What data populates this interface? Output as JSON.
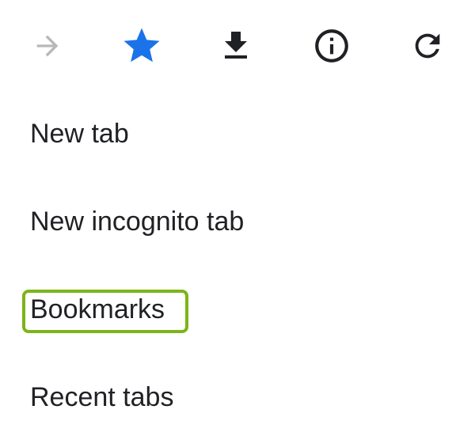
{
  "toolbar": {
    "buttons": [
      {
        "icon": "arrow-forward-icon",
        "state": "disabled"
      },
      {
        "icon": "star-icon",
        "state": "active"
      },
      {
        "icon": "download-icon",
        "state": "normal"
      },
      {
        "icon": "info-icon",
        "state": "normal"
      },
      {
        "icon": "refresh-icon",
        "state": "normal"
      }
    ]
  },
  "menu": {
    "items": [
      {
        "label": "New tab"
      },
      {
        "label": "New incognito tab"
      },
      {
        "label": "Bookmarks"
      },
      {
        "label": "Recent tabs"
      }
    ]
  },
  "colors": {
    "icon_default": "#202124",
    "icon_disabled": "#b8b8b8",
    "icon_active": "#1a73e8",
    "highlight_border": "#7cb518"
  }
}
